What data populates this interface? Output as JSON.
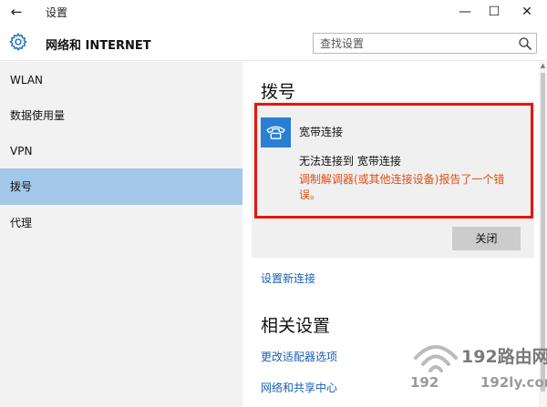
{
  "window": {
    "title": "设置",
    "back_icon": "←",
    "minimize_icon": "—",
    "maximize_icon": "☐",
    "close_icon": "✕"
  },
  "header": {
    "title": "网络和 INTERNET",
    "search_placeholder": "查找设置"
  },
  "sidebar": {
    "items": [
      {
        "label": "WLAN",
        "active": false
      },
      {
        "label": "数据使用量",
        "active": false
      },
      {
        "label": "VPN",
        "active": false
      },
      {
        "label": "拨号",
        "active": true
      },
      {
        "label": "代理",
        "active": false
      }
    ]
  },
  "main": {
    "dial_title": "拨号",
    "connection": {
      "name": "宽带连接",
      "status": "无法连接到 宽带连接",
      "error": "调制解调器(或其他连接设备)报告了一个错误。",
      "close_label": "关闭"
    },
    "new_connection_link": "设置新连接",
    "related_title": "相关设置",
    "related_links": [
      "更改适配器选项",
      "网络和共享中心"
    ]
  },
  "watermark": {
    "logo_text": "192路由网",
    "sub_left": "192",
    "sub_right": "192ly.com"
  },
  "colors": {
    "accent": "#2a7ed3",
    "active_bg": "#a3c8e8",
    "highlight_border": "#e8140c",
    "error_text": "#e04e12",
    "link": "#1a5fb4"
  }
}
